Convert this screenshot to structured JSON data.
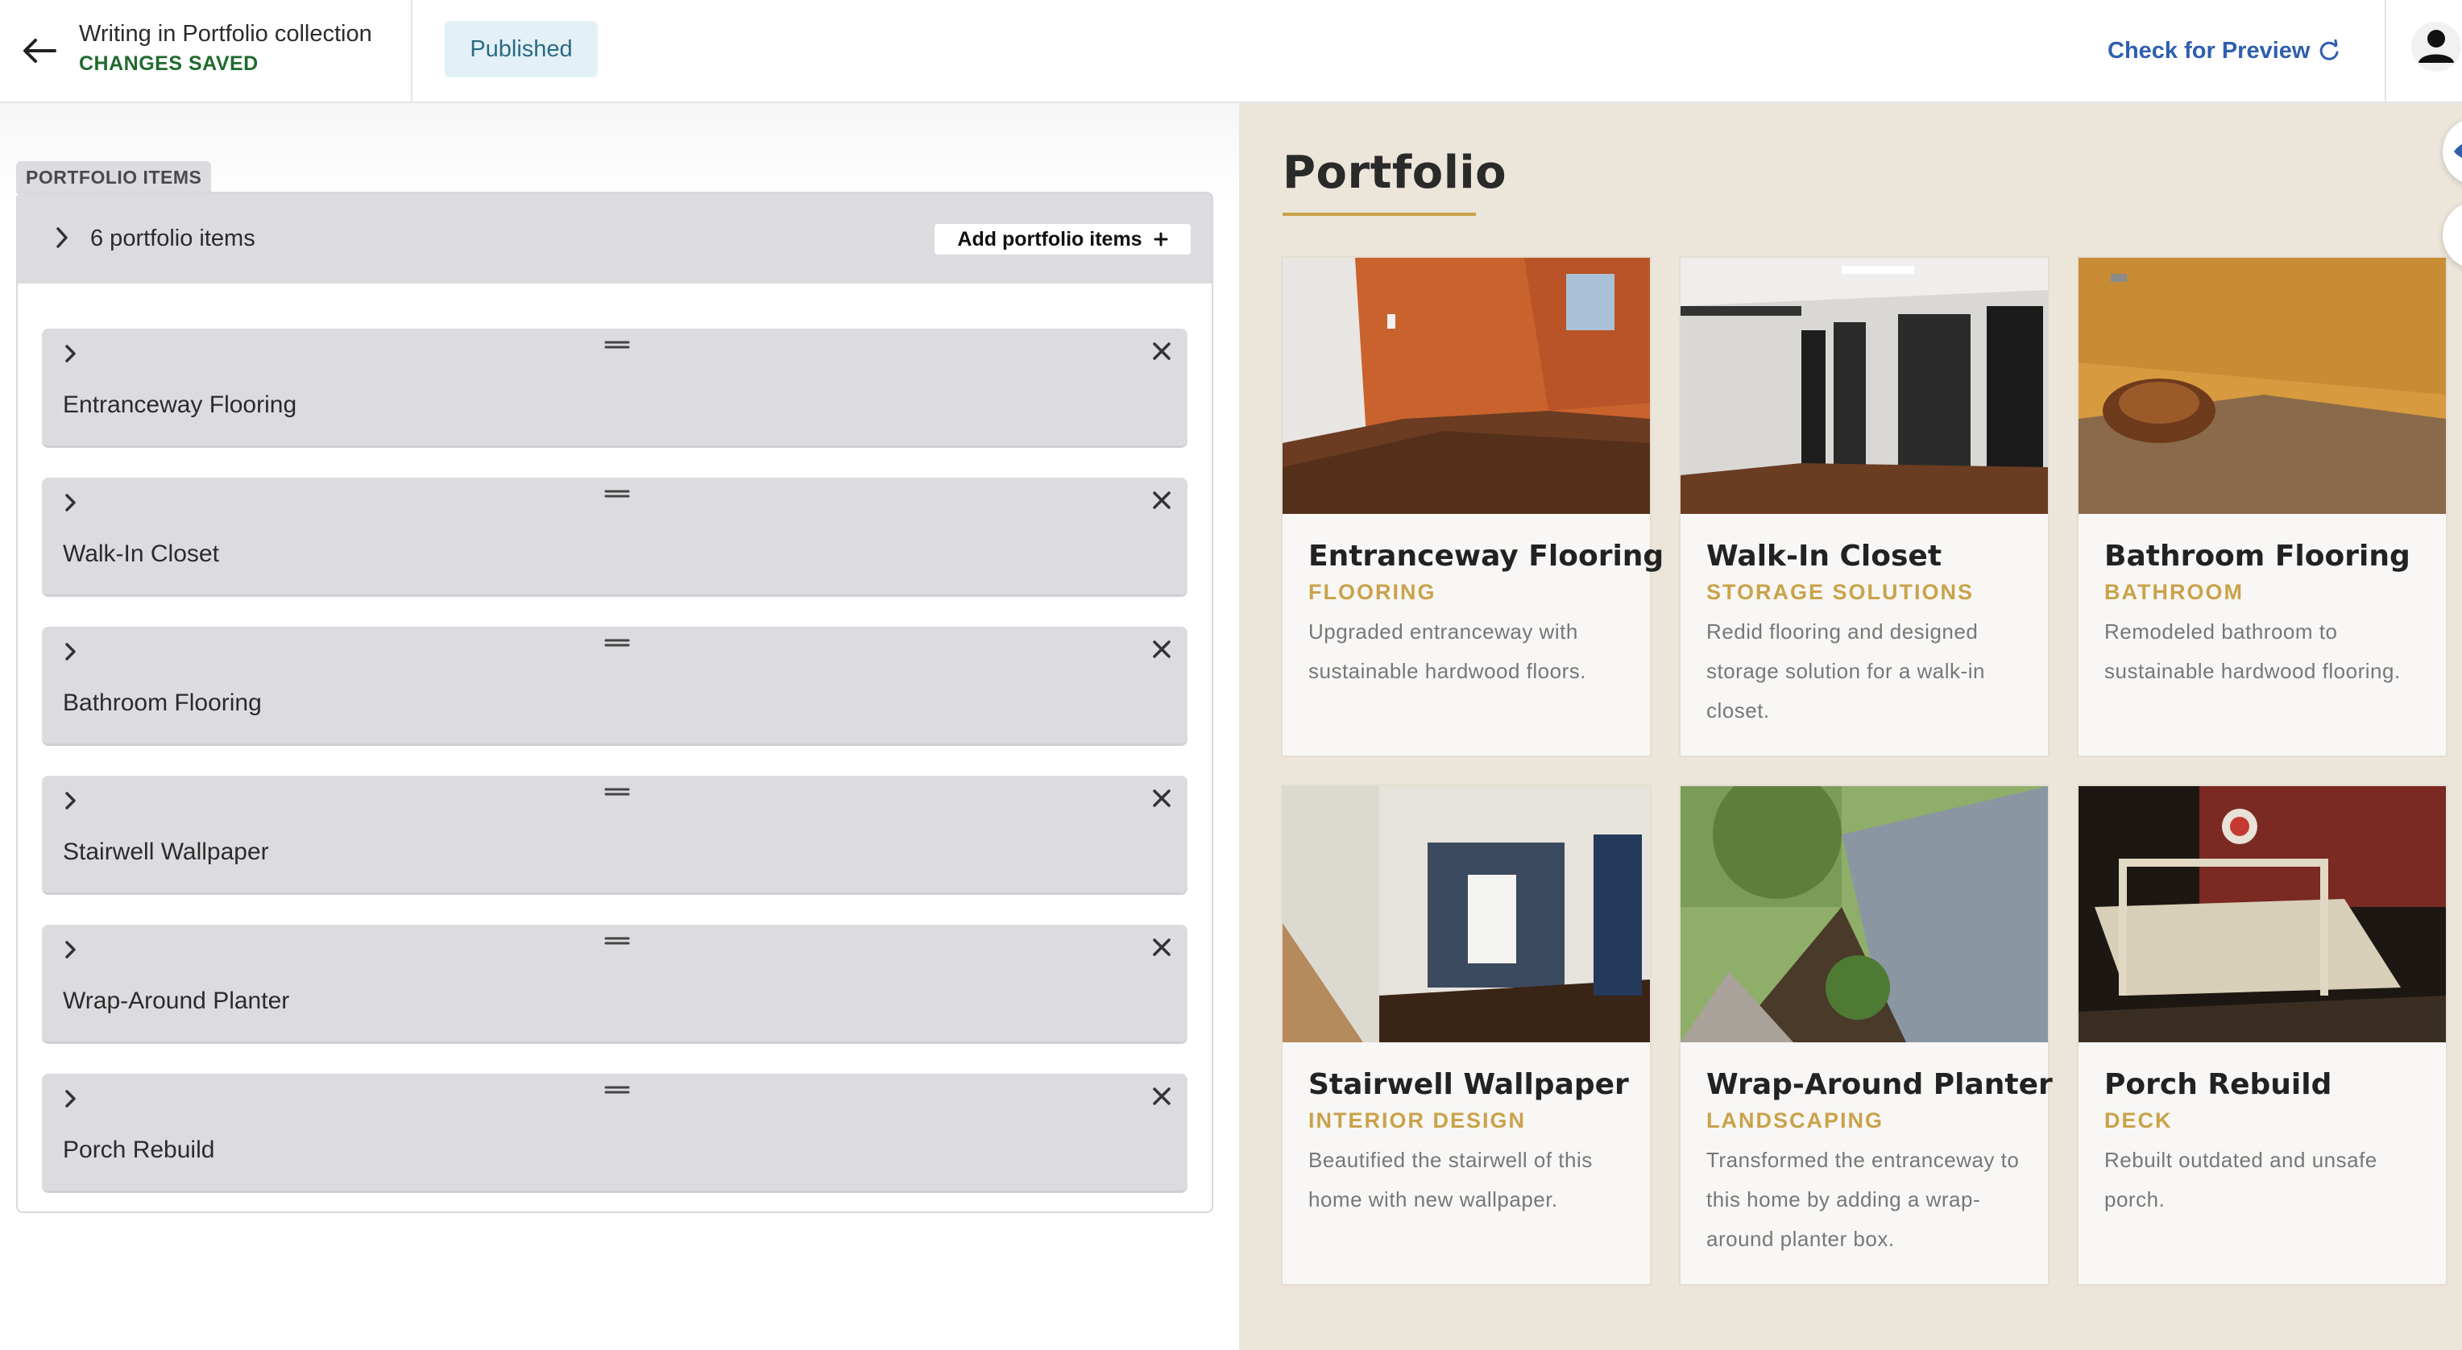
{
  "header": {
    "title": "Writing in Portfolio collection",
    "save_status": "CHANGES SAVED",
    "status_badge": "Published",
    "preview_label": "Check for Preview"
  },
  "editor": {
    "section_label": "PORTFOLIO ITEMS",
    "items_count": "6 portfolio items",
    "add_button": "Add portfolio items",
    "items": [
      {
        "label": "Entranceway Flooring"
      },
      {
        "label": "Walk-In Closet"
      },
      {
        "label": "Bathroom Flooring"
      },
      {
        "label": "Stairwell Wallpaper"
      },
      {
        "label": "Wrap-Around Planter"
      },
      {
        "label": "Porch Rebuild"
      }
    ]
  },
  "preview": {
    "heading": "Portfolio",
    "cards": [
      {
        "title": "Entranceway Flooring",
        "category": "FLOORING",
        "description": "Upgraded entranceway with sustainable hardwood floors."
      },
      {
        "title": "Walk-In Closet",
        "category": "STORAGE SOLUTIONS",
        "description": "Redid flooring and designed storage solution for a walk-in closet."
      },
      {
        "title": "Bathroom Flooring",
        "category": "BATHROOM",
        "description": "Remodeled bathroom to sustainable hardwood flooring."
      },
      {
        "title": "Stairwell Wallpaper",
        "category": "INTERIOR DESIGN",
        "description": "Beautified the stairwell of this home with new wallpaper."
      },
      {
        "title": "Wrap-Around Planter",
        "category": "LANDSCAPING",
        "description": "Transformed the entranceway to this home by adding a wrap-around planter box."
      },
      {
        "title": "Porch Rebuild",
        "category": "DECK",
        "description": "Rebuilt outdated and unsafe porch."
      }
    ]
  },
  "colors": {
    "accent_gold": "#c9a24a",
    "link_blue": "#2f5fae",
    "saved_green": "#1f6b2e",
    "preview_bg": "#ece5da"
  },
  "icons": [
    "arrow-left-icon",
    "refresh-icon",
    "user-avatar-icon",
    "chevron-right-icon",
    "drag-handle-icon",
    "close-icon",
    "plus-icon",
    "eye-icon",
    "vertical-resize-icon"
  ]
}
